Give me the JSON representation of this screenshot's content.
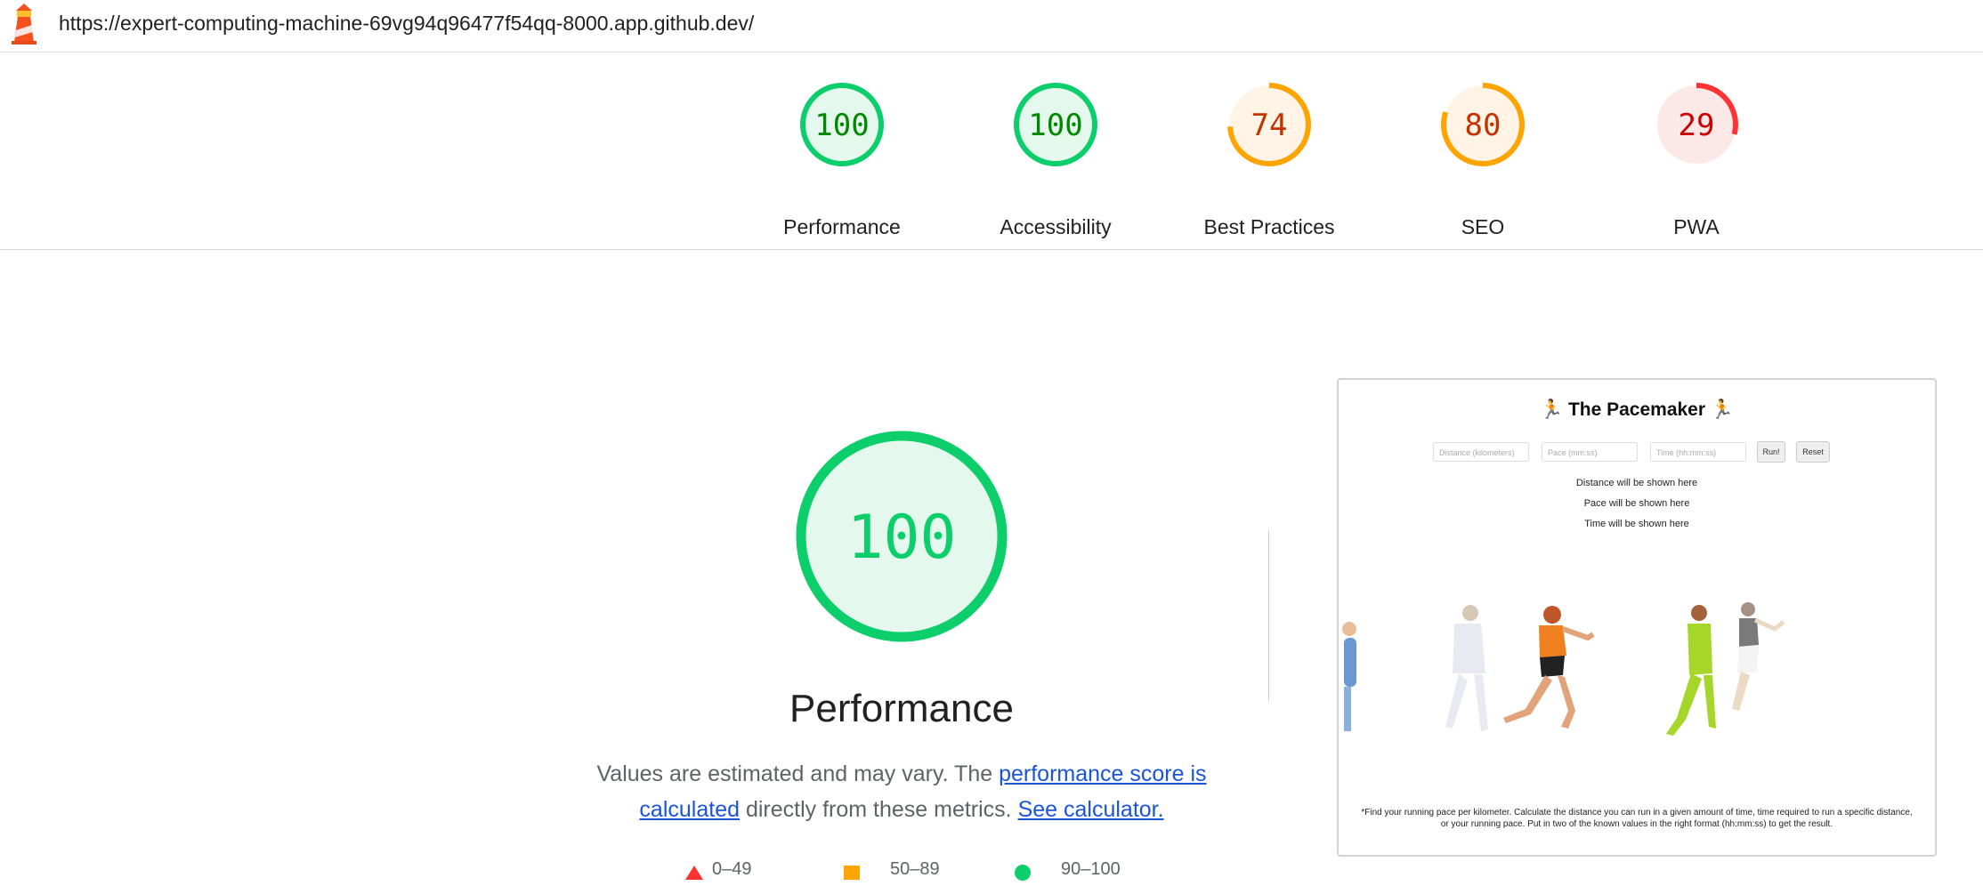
{
  "url_bar": {
    "url": "https://expert-computing-machine-69vg94q96477f54qq-8000.app.github.dev/"
  },
  "summary": {
    "gauges": [
      {
        "label": "Performance",
        "score": "100",
        "value": 100,
        "rating": "pass"
      },
      {
        "label": "Accessibility",
        "score": "100",
        "value": 100,
        "rating": "pass"
      },
      {
        "label": "Best Practices",
        "score": "74",
        "value": 74,
        "rating": "average"
      },
      {
        "label": "SEO",
        "score": "80",
        "value": 80,
        "rating": "average"
      },
      {
        "label": "PWA",
        "score": "29",
        "value": 29,
        "rating": "fail"
      }
    ]
  },
  "colors": {
    "pass": "#0cce6b",
    "pass_text": "#008800",
    "pass_bg": "#e5f8ee",
    "average": "#ffa400",
    "average_text": "#c33300",
    "average_bg": "#fff4e5",
    "fail": "#ff3333",
    "fail_text": "#cc0000",
    "fail_bg": "#fde8e8",
    "big_text": "#0cce6b",
    "link": "#1a55d8"
  },
  "main": {
    "score": "100",
    "value": 100,
    "title": "Performance",
    "desc_before": "Values are estimated and may vary. The ",
    "desc_link1": "performance score is calculated",
    "desc_middle": " directly from these metrics. ",
    "desc_link2": "See calculator.",
    "legend": [
      "0–49",
      "50–89",
      "90–100"
    ]
  },
  "preview": {
    "title": "The Pacemaker",
    "inputs": [
      "Distance (kilometers)",
      "Pace (mm:ss)",
      "Time (hh:mm:ss)"
    ],
    "buttons": [
      "Run!",
      "Reset"
    ],
    "lines": [
      "Distance will be shown here",
      "Pace will be shown here",
      "Time will be shown here"
    ],
    "footer": "*Find your running pace per kilometer. Calculate the distance you can run in a given amount of time, time required to run a specific distance, or your running pace. Put in two of the known values in the right format (hh:mm:ss) to get the result."
  }
}
